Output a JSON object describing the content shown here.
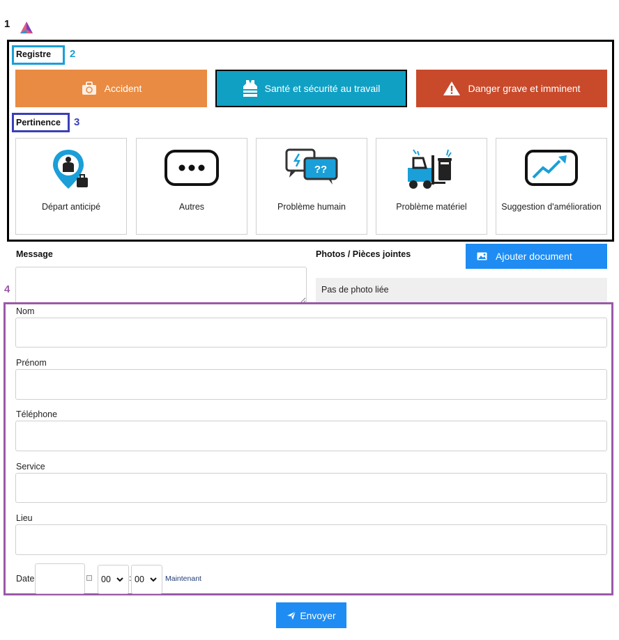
{
  "annotations": {
    "n1": "1",
    "n2": "2",
    "n3": "3",
    "n4": "4"
  },
  "colors": {
    "orange": "#e98b42",
    "teal": "#0fa0c4",
    "red": "#c84a2b",
    "blue": "#1e8cf2",
    "purple": "#9b59a8",
    "annot_blue": "#1a9fd8",
    "annot_indigo": "#3b3fb8"
  },
  "registre": {
    "label": "Registre",
    "buttons": [
      {
        "label": "Accident",
        "icon": "first-aid-kit-icon"
      },
      {
        "label": "Santé et sécurité au travail",
        "icon": "safety-vest-icon"
      },
      {
        "label": "Danger grave et imminent",
        "icon": "warning-icon"
      }
    ]
  },
  "pertinence": {
    "label": "Pertinence",
    "cards": [
      {
        "label": "Départ anticipé",
        "icon": "person-pin-luggage-icon"
      },
      {
        "label": "Autres",
        "icon": "ellipsis-bubble-icon"
      },
      {
        "label": "Problème humain",
        "icon": "speech-bubbles-icon"
      },
      {
        "label": "Problème matériel",
        "icon": "forklift-icon"
      },
      {
        "label": "Suggestion d'amélioration",
        "icon": "trend-chart-icon"
      }
    ]
  },
  "message": {
    "label": "Message",
    "value": ""
  },
  "photos": {
    "label": "Photos / Pièces jointes",
    "button": "Ajouter document",
    "empty": "Pas de photo liée"
  },
  "form": {
    "fields": [
      {
        "label": "Nom",
        "value": ""
      },
      {
        "label": "Prénom",
        "value": ""
      },
      {
        "label": "Téléphone",
        "value": ""
      },
      {
        "label": "Service",
        "value": ""
      },
      {
        "label": "Lieu",
        "value": ""
      }
    ],
    "date": {
      "label": "Date",
      "value": "",
      "hour": "00",
      "minute": "00",
      "separator": ":",
      "now_link": "Maintenant"
    }
  },
  "submit": {
    "label": "Envoyer"
  }
}
